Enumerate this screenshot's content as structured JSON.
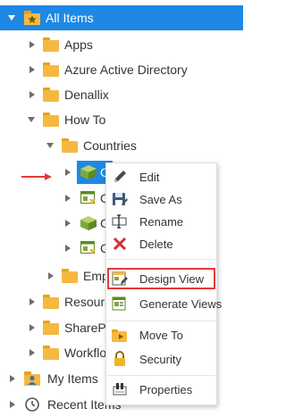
{
  "tree": {
    "root": {
      "label": "All Items",
      "icon": "all-items-icon"
    },
    "items": [
      {
        "label": "Apps",
        "icon": "folder-icon"
      },
      {
        "label": "Azure Active Directory",
        "icon": "folder-icon"
      },
      {
        "label": "Denallix",
        "icon": "folder-icon"
      },
      {
        "label": "How To",
        "icon": "folder-icon"
      },
      {
        "label": "Countries",
        "icon": "folder-icon"
      },
      {
        "label": "C",
        "icon": "smartobject-icon"
      },
      {
        "label": "C",
        "icon": "view-icon"
      },
      {
        "label": "C",
        "icon": "smartobject-icon"
      },
      {
        "label": "C",
        "icon": "view-icon"
      },
      {
        "label": "Emp",
        "icon": "folder-icon"
      },
      {
        "label": "Resour",
        "icon": "folder-icon"
      },
      {
        "label": "SharePo",
        "icon": "folder-icon"
      },
      {
        "label": "Workflo",
        "icon": "folder-icon"
      },
      {
        "label": "My Items",
        "icon": "user-icon"
      },
      {
        "label": "Recent Items",
        "icon": "clock-icon"
      }
    ]
  },
  "context_menu": {
    "items": [
      {
        "label": "Edit",
        "icon": "pencil-icon"
      },
      {
        "label": "Save As",
        "icon": "save-icon"
      },
      {
        "label": "Rename",
        "icon": "rename-icon"
      },
      {
        "label": "Delete",
        "icon": "delete-icon"
      },
      {
        "label": "Design View",
        "icon": "design-view-icon"
      },
      {
        "label": "Generate Views",
        "icon": "generate-views-icon"
      },
      {
        "label": "Move To",
        "icon": "move-icon"
      },
      {
        "label": "Security",
        "icon": "lock-icon"
      },
      {
        "label": "Properties",
        "icon": "properties-icon"
      }
    ],
    "highlighted": "Design View"
  },
  "colors": {
    "selection": "#1e88e5",
    "folder": "#f5b942",
    "arrow": "#e53935",
    "highlight_border": "#e53935"
  }
}
